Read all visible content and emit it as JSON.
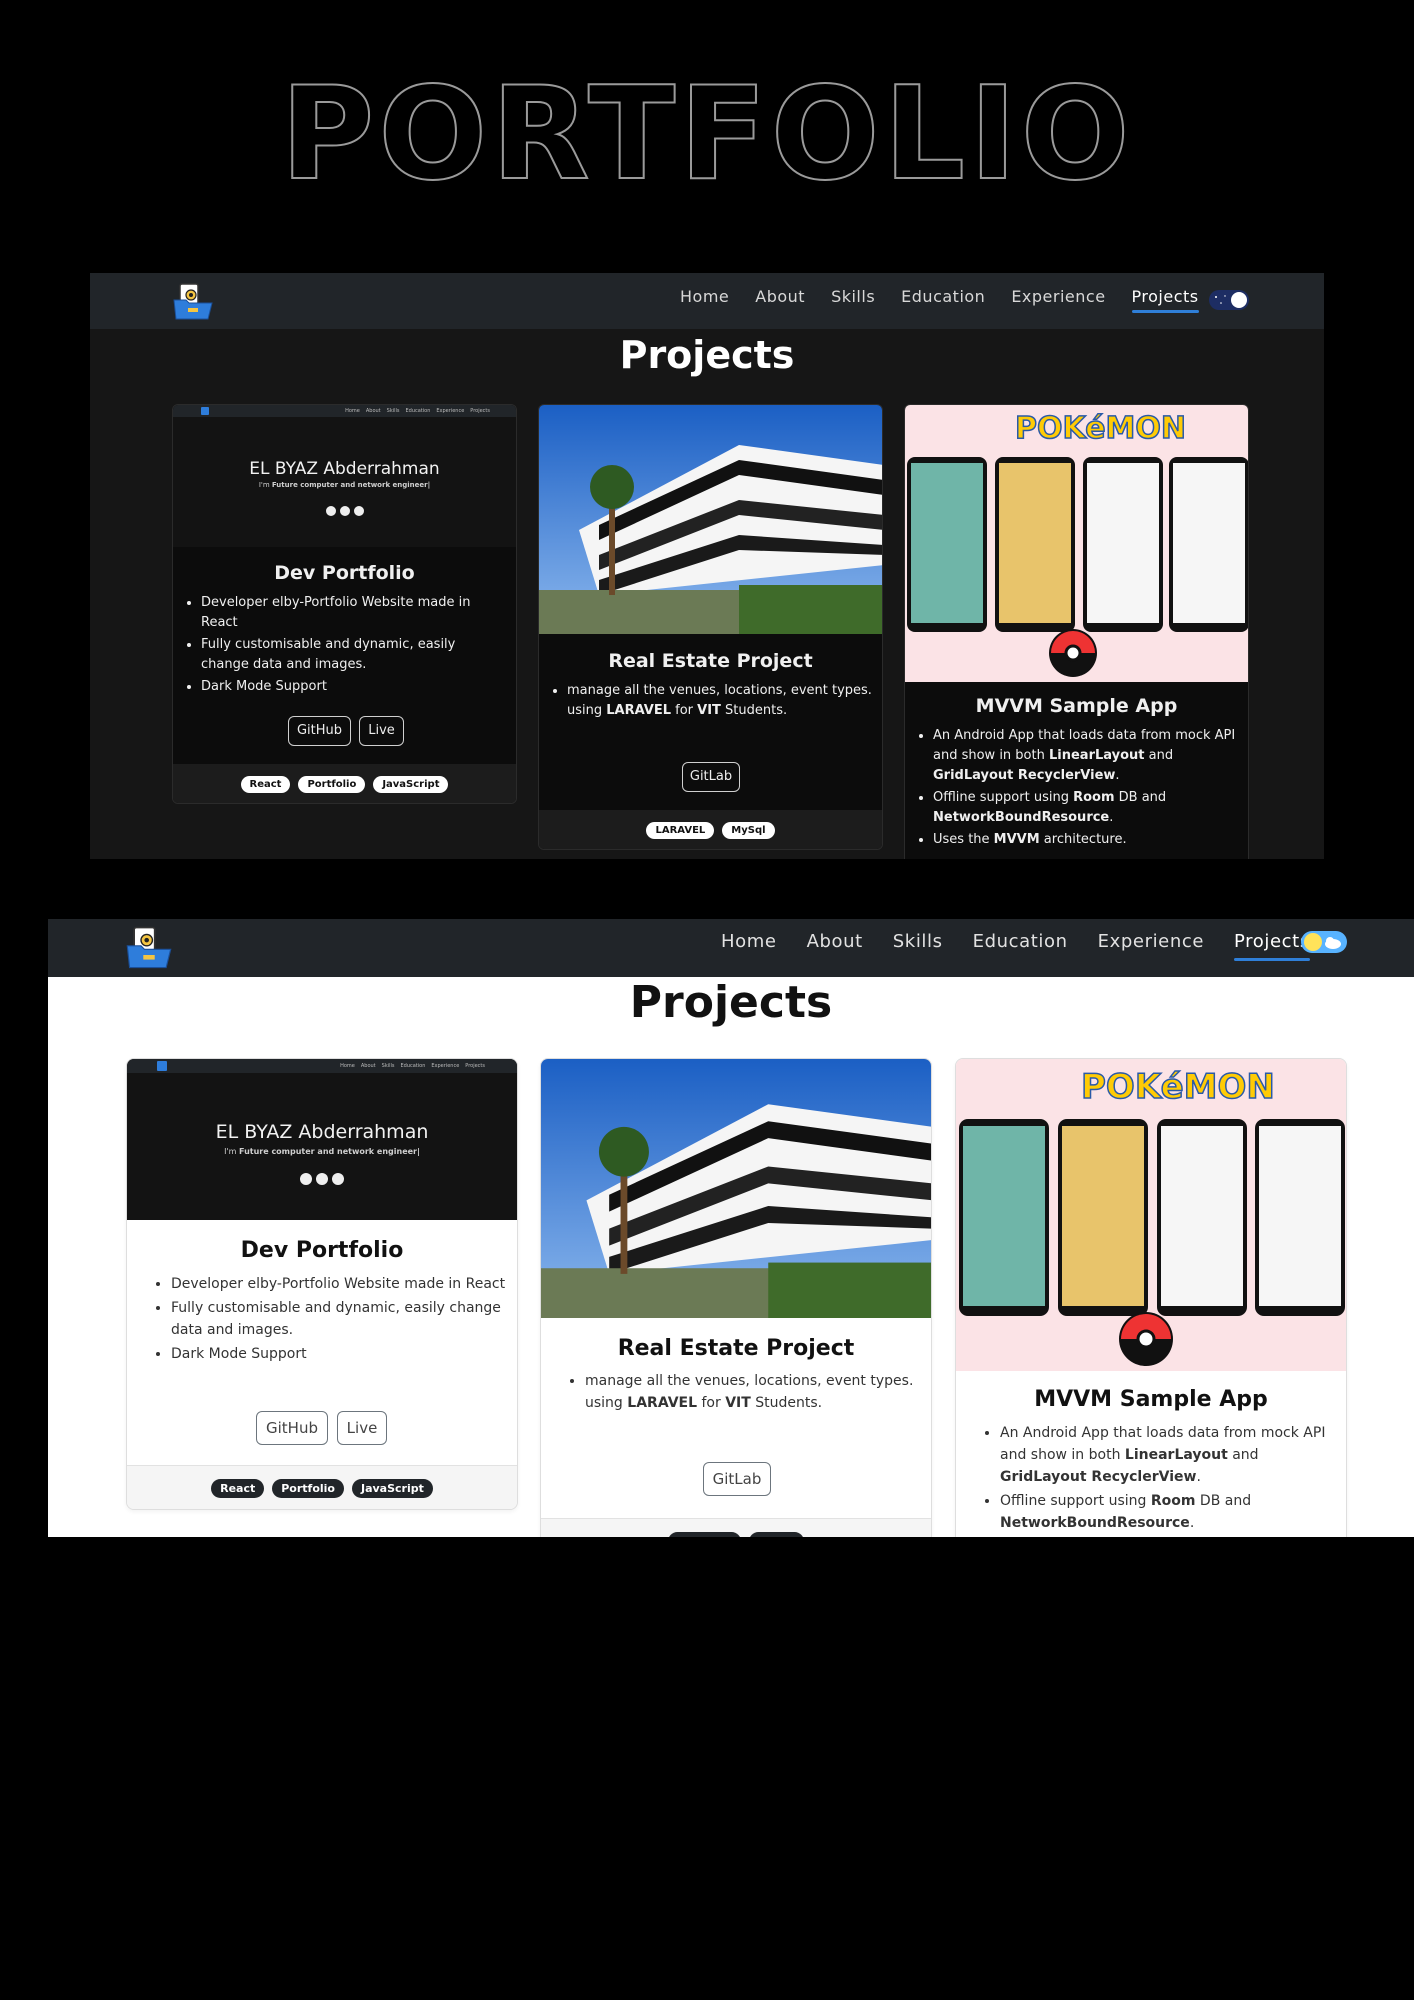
{
  "hero_title": "PORTFOLIO",
  "nav": {
    "links": [
      "Home",
      "About",
      "Skills",
      "Education",
      "Experience",
      "Projects"
    ],
    "active": "Projects"
  },
  "section_title": "Projects",
  "preview": {
    "name": "EL BYAZ Abderrahman",
    "tagline_prefix": "I'm ",
    "tagline_bold": "Future computer and network engineer|"
  },
  "cards": {
    "dev": {
      "title": "Dev Portfolio",
      "bullets": [
        "Developer elby-Portfolio Website made in React",
        "Fully customisable and dynamic, easily change data and images.",
        "Dark Mode Support"
      ],
      "buttons": [
        "GitHub",
        "Live"
      ],
      "tags": [
        "React",
        "Portfolio",
        "JavaScript"
      ]
    },
    "realestate": {
      "title": "Real Estate Project",
      "bullet_parts": [
        "manage all the venues, locations, event types. using ",
        "LARAVEL",
        " for ",
        "VIT",
        " Students."
      ],
      "buttons": [
        "GitLab"
      ],
      "tags": [
        "LARAVEL",
        "MySql"
      ]
    },
    "mvvm": {
      "title": "MVVM Sample App",
      "b1": [
        "An Android App that loads data from mock API and show in both ",
        "LinearLayout",
        " and ",
        "GridLayout RecyclerView",
        "."
      ],
      "b2": [
        "Offline support using ",
        "Room",
        " DB and ",
        "NetworkBoundResource",
        "."
      ],
      "b3": [
        "Uses the ",
        "MVVM",
        " architecture."
      ],
      "image_text": "POKéMON"
    }
  },
  "colors": {
    "accent": "#2f7fd8",
    "dark_navbar": "#212529",
    "page_bg": "#000000"
  }
}
